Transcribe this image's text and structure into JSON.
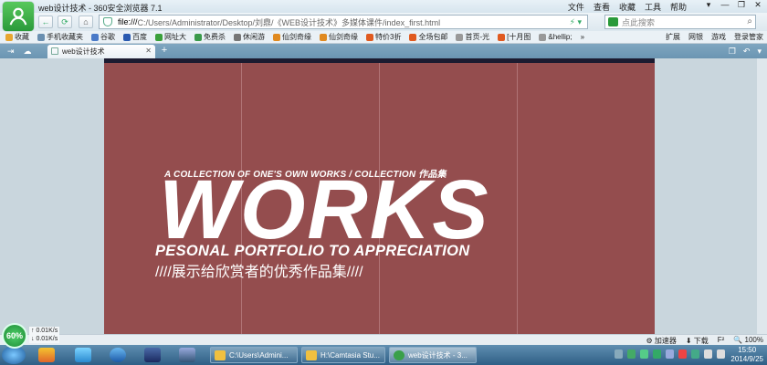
{
  "window": {
    "title": "web设计技术 - 360安全浏览器 7.1",
    "menu": [
      "文件",
      "查看",
      "收藏",
      "工具",
      "帮助"
    ],
    "controls": [
      "▾",
      "—",
      "❐",
      "✕"
    ]
  },
  "navigation": {
    "address_scheme": "file:///",
    "address_path": "C:/Users/Administrator/Desktop/刘鼎/《WEB设计技术》多媒体课件/index_first.html",
    "search_placeholder": "点此搜索"
  },
  "bookmarks": {
    "items": [
      {
        "label": "收藏",
        "color": "#e8a630"
      },
      {
        "label": "手机收藏夹",
        "color": "#6a8fb0"
      },
      {
        "label": "谷歌",
        "color": "#4a7ac8"
      },
      {
        "label": "百度",
        "color": "#2a5ab0"
      },
      {
        "label": "网址大",
        "color": "#3aa03a"
      },
      {
        "label": "免费杀",
        "color": "#3a9a4a"
      },
      {
        "label": "休闲游",
        "color": "#777777"
      },
      {
        "label": "仙剑奇缘",
        "color": "#e08a20"
      },
      {
        "label": "仙剑奇缘",
        "color": "#e08a20"
      },
      {
        "label": "特价3折",
        "color": "#e05a20"
      },
      {
        "label": "全场包邮",
        "color": "#e05a20"
      },
      {
        "label": "首页-光",
        "color": "#999999"
      },
      {
        "label": "[十月图",
        "color": "#e05a20"
      },
      {
        "label": "&hellip;",
        "color": "#999999"
      }
    ],
    "more": "»",
    "right": [
      "扩展",
      "网银",
      "游戏",
      "登录管家"
    ]
  },
  "tabs": {
    "active_label": "web设计技术",
    "add": "+"
  },
  "page": {
    "kicker": "A COLLECTION OF ONE'S OWN WORKS / COLLECTION 作品集",
    "headline": "WORKS",
    "subtitle": "PESONAL PORTFOLIO TO APPRECIATION",
    "chinese": "////展示给欣赏者的优秀作品集////",
    "background_color": "#944d4e"
  },
  "status": {
    "speed_percent": "60%",
    "upload": "0.01K/s",
    "download": "0.01K/s",
    "right_items": [
      "加速器",
      "下载",
      "F²",
      "100%"
    ]
  },
  "taskbar": {
    "tasks": [
      {
        "label": "C:\\Users\\Admini...",
        "active": false
      },
      {
        "label": "H:\\Camtasia Stu...",
        "active": false
      },
      {
        "label": "web设计技术 - 3...",
        "active": true
      }
    ],
    "time": "15:50",
    "date": "2014/9/25"
  }
}
